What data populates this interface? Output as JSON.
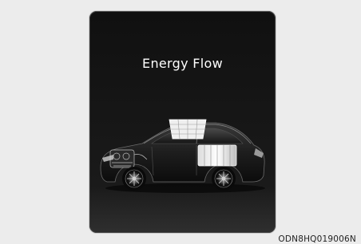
{
  "screen": {
    "title": "Energy Flow"
  },
  "illustration": {
    "icon": "hybrid-car-energy-flow-icon",
    "components": [
      "engine",
      "solar-roof-panel",
      "battery-pack"
    ]
  },
  "figure_code": "ODN8HQ019006N"
}
